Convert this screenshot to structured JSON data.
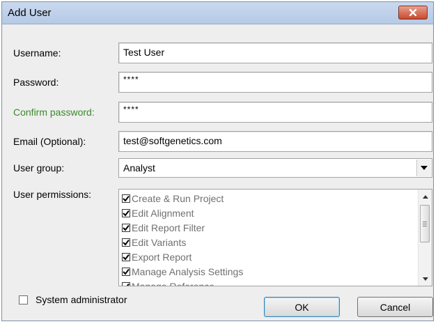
{
  "window": {
    "title": "Add User"
  },
  "labels": {
    "username": "Username:",
    "password": "Password:",
    "confirm_password": "Confirm password:",
    "email": "Email (Optional):",
    "user_group": "User group:",
    "user_permissions": "User permissions:"
  },
  "fields": {
    "username": "Test User",
    "password": "****",
    "confirm_password": "****",
    "email": "test@softgenetics.com"
  },
  "user_group": {
    "selected": "Analyst"
  },
  "permissions": [
    {
      "label": "Create & Run Project",
      "checked": true
    },
    {
      "label": "Edit Alignment",
      "checked": true
    },
    {
      "label": "Edit Report Filter",
      "checked": true
    },
    {
      "label": "Edit Variants",
      "checked": true
    },
    {
      "label": "Export Report",
      "checked": true
    },
    {
      "label": "Manage Analysis Settings",
      "checked": true
    },
    {
      "label": "Manage Reference",
      "checked": true
    }
  ],
  "system_admin": {
    "label": "System administrator",
    "checked": false
  },
  "buttons": {
    "ok": "OK",
    "cancel": "Cancel"
  },
  "icons": {
    "close": "close-icon",
    "dropdown": "chevron-down-icon",
    "scroll_up": "scroll-up-icon",
    "scroll_down": "scroll-down-icon",
    "checkmark": "checkmark-icon"
  },
  "colors": {
    "confirm_label": "#3a8a2a",
    "titlebar": "#c4d5ec",
    "close_button": "#c84a2f"
  }
}
